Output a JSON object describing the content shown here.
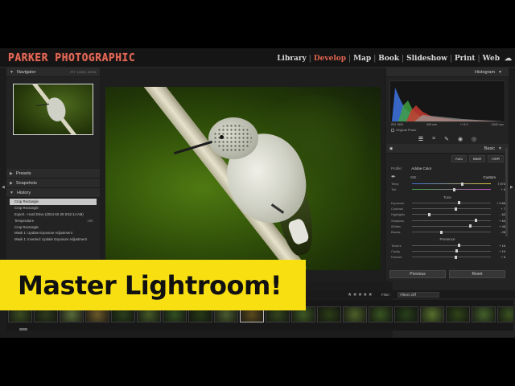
{
  "colors": {
    "brand": "#e06a56",
    "active_module": "#e0634f",
    "banner_bg": "#f7df12",
    "banner_text": "#111111"
  },
  "brand": "PARKER PHOTOGRAPHIC",
  "modules": [
    "Library",
    "Develop",
    "Map",
    "Book",
    "Slideshow",
    "Print",
    "Web"
  ],
  "active_module": "Develop",
  "left_panel": {
    "navigator": {
      "title": "Navigator",
      "zoom": "FIT   100%   200%"
    },
    "presets": "Presets",
    "snapshots": "Snapshots",
    "history": {
      "title": "History",
      "items": [
        {
          "label": "Crop Rectangle",
          "value": ""
        },
        {
          "label": "Crop Rectangle",
          "value": ""
        },
        {
          "label": "Export - Hard Drive (2024-02-28 8:52:14 AM)",
          "value": ""
        },
        {
          "label": "Temperature",
          "value": "19K"
        },
        {
          "label": "Crop Rectangle",
          "value": ""
        },
        {
          "label": "Mask 1: Update Exposure Adjustment",
          "value": ""
        },
        {
          "label": "Mask 1: Inverted: Update Exposure Adjustment",
          "value": ""
        }
      ],
      "selected_index": 0
    }
  },
  "right_panel": {
    "histogram_title": "Histogram",
    "hist_info": [
      "ISO 1600",
      "500 mm",
      "f / 6.3",
      "1/640 sec"
    ],
    "original_photo": "Original Photo",
    "tool_icons": [
      "edit-icon",
      "crop-icon",
      "heal-icon",
      "redeye-icon",
      "mask-icon"
    ],
    "basic": {
      "title": "Basic",
      "treatments": [
        "Auto",
        "B&W",
        "HDR"
      ],
      "profile_label": "Profile :",
      "profile_value": "Adobe Color",
      "wb_label": "WB :",
      "wb_value": "Custom",
      "temp_row": {
        "label": "Temp",
        "value": "7,973",
        "pos": 0.62
      },
      "tint_row": {
        "label": "Tint",
        "value": "+ 9",
        "pos": 0.52
      },
      "tone_label": "Tone",
      "tone": [
        {
          "label": "Exposure",
          "value": "+ 0.66",
          "pos": 0.58
        },
        {
          "label": "Contrast",
          "value": "+ 7",
          "pos": 0.54
        },
        {
          "label": "Highlights",
          "value": "- 63",
          "pos": 0.2
        },
        {
          "label": "Shadows",
          "value": "+ 64",
          "pos": 0.8
        },
        {
          "label": "Whites",
          "value": "+ 46",
          "pos": 0.72
        },
        {
          "label": "Blacks",
          "value": "- 28",
          "pos": 0.36
        }
      ],
      "presence_label": "Presence",
      "presence": [
        {
          "label": "Texture",
          "value": "+ 16",
          "pos": 0.58
        },
        {
          "label": "Clarity",
          "value": "+ 10",
          "pos": 0.55
        },
        {
          "label": "Dehaze",
          "value": "+ 8",
          "pos": 0.54
        }
      ]
    },
    "buttons": {
      "previous": "Previous",
      "reset": "Reset"
    }
  },
  "filmstrip": {
    "filter_label": "Filter :",
    "filter_value": "Filters Off",
    "stars": "★★★★★",
    "thumb_colors": [
      "#3a4c20",
      "#2d3b1c",
      "#5a6b3a",
      "#6c5a2a",
      "#2a3f1a",
      "#435a26",
      "#315020",
      "#263a14",
      "#4a5c2e",
      "#5b4a1e",
      "#32451c",
      "#3e5a24",
      "#2b3c16",
      "#4c6128",
      "#385420",
      "#28401a",
      "#56702c",
      "#2e4418",
      "#44602a",
      "#3a5220"
    ],
    "selected_index": 9
  },
  "banner": {
    "text": "Master Lightroom!"
  }
}
